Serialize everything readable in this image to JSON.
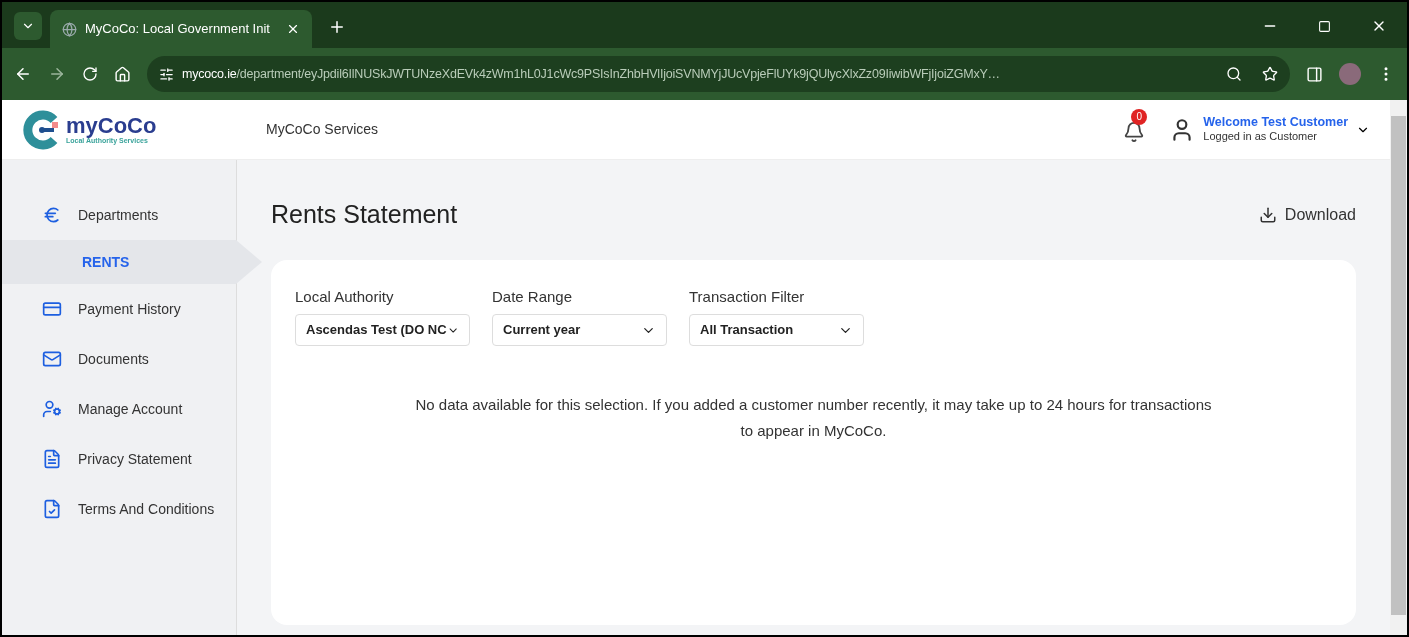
{
  "browser": {
    "tab_title": "MyCoCo: Local Government Init",
    "url_domain": "mycoco.ie",
    "url_path": "/department/eyJpdil6IlNUSkJWTUNzeXdEVk4zWm1hL0J1cWc9PSIsInZhbHVlIjoiSVNMYjJUcVpjeFlUYk9jQUlycXlxZz09IiwibWFjIjoiZGMxY…"
  },
  "header": {
    "logo_text": "myCoCo",
    "logo_subtitle": "Local Authority Services",
    "nav": "MyCoCo Services",
    "notification_count": "0",
    "welcome": "Welcome Test Customer",
    "role": "Logged in as Customer"
  },
  "sidebar": {
    "items": [
      {
        "label": "Departments",
        "selected": false,
        "children": [
          {
            "label": "RENTS",
            "selected": true
          }
        ]
      },
      {
        "label": "Payment History",
        "selected": false
      },
      {
        "label": "Documents",
        "selected": false
      },
      {
        "label": "Manage Account",
        "selected": false
      },
      {
        "label": "Privacy Statement",
        "selected": false
      },
      {
        "label": "Terms And Conditions",
        "selected": false
      }
    ]
  },
  "page": {
    "title": "Rents Statement",
    "download": "Download",
    "filters": [
      {
        "label": "Local Authority",
        "value": "Ascendas Test (DO NC"
      },
      {
        "label": "Date Range",
        "value": "Current year"
      },
      {
        "label": "Transaction Filter",
        "value": "All Transaction"
      }
    ],
    "empty_message": "No data available for this selection. If you added a customer number recently, it may take up to 24 hours for transactions to appear in MyCoCo."
  }
}
